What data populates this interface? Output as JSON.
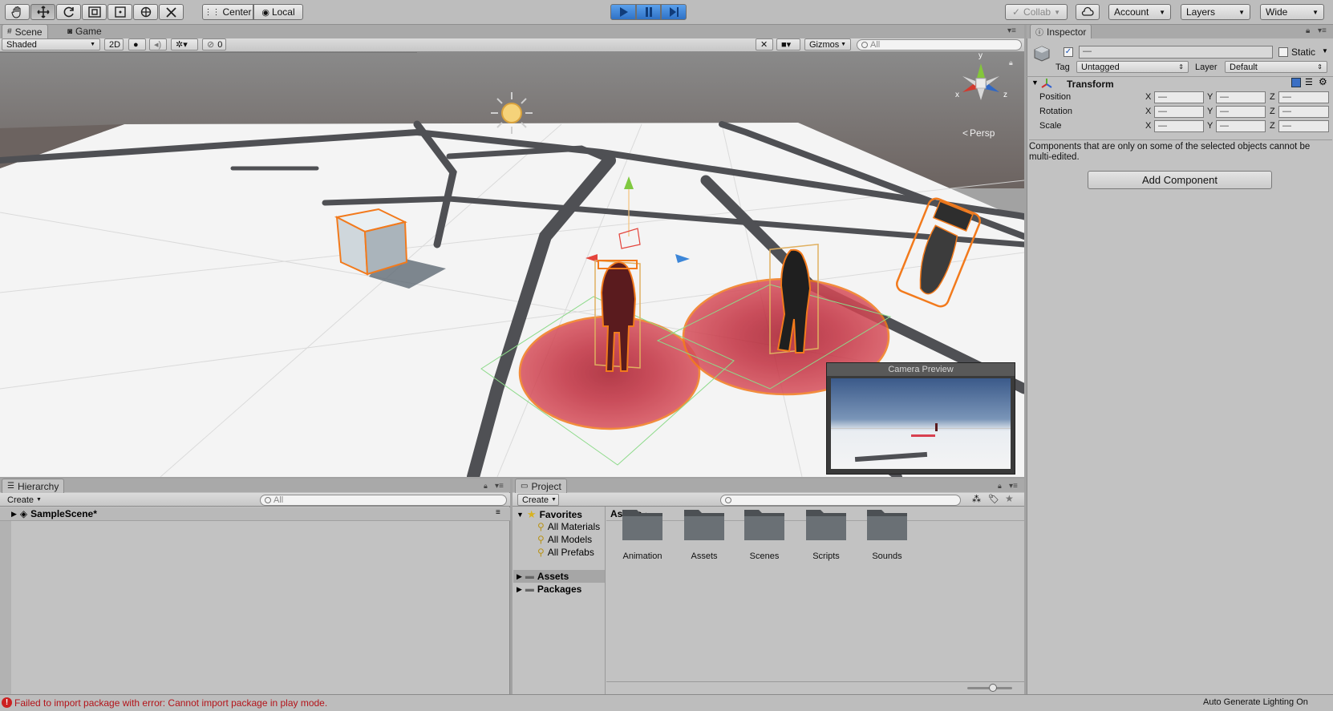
{
  "toolbar": {
    "pivot_label": "Center",
    "space_label": "Local",
    "collab_label": "Collab",
    "account_label": "Account",
    "layers_label": "Layers",
    "layout_label": "Wide"
  },
  "scene": {
    "tab_scene": "Scene",
    "tab_game": "Game",
    "shading_mode": "Shaded",
    "mode_2d": "2D",
    "hidden_count": "0",
    "gizmos_label": "Gizmos",
    "search_placeholder": "All",
    "persp_label": "Persp",
    "camera_preview_title": "Camera Preview",
    "axis_x": "x",
    "axis_y": "y",
    "axis_z": "z"
  },
  "inspector": {
    "tab_label": "Inspector",
    "name_value": "—",
    "static_label": "Static",
    "tag_label": "Tag",
    "tag_value": "Untagged",
    "layer_label": "Layer",
    "layer_value": "Default",
    "component_title": "Transform",
    "rows": [
      {
        "label": "Position",
        "x": "—",
        "y": "—",
        "z": "—"
      },
      {
        "label": "Rotation",
        "x": "—",
        "y": "—",
        "z": "—"
      },
      {
        "label": "Scale",
        "x": "—",
        "y": "—",
        "z": "—"
      }
    ],
    "axis_x": "X",
    "axis_y": "Y",
    "axis_z": "Z",
    "multi_edit_note": "Components that are only on some of the selected objects cannot be multi-edited.",
    "add_component_label": "Add Component"
  },
  "hierarchy": {
    "tab_label": "Hierarchy",
    "create_label": "Create",
    "search_placeholder": "All",
    "scene_name": "SampleScene*"
  },
  "project": {
    "tab_label": "Project",
    "create_label": "Create",
    "favorites_label": "Favorites",
    "favorites": [
      "All Materials",
      "All Models",
      "All Prefabs"
    ],
    "assets_root": "Assets",
    "packages_root": "Packages",
    "breadcrumb": "Assets",
    "folders": [
      "Animation",
      "Assets",
      "Scenes",
      "Scripts",
      "Sounds"
    ]
  },
  "status": {
    "error_message": "Failed to import package with error: Cannot import package in play mode.",
    "lighting_status": "Auto Generate Lighting On"
  },
  "colors": {
    "play_active": "#3c84d8",
    "selection_outline": "#f57c20",
    "error_red": "#cc1f1f"
  }
}
